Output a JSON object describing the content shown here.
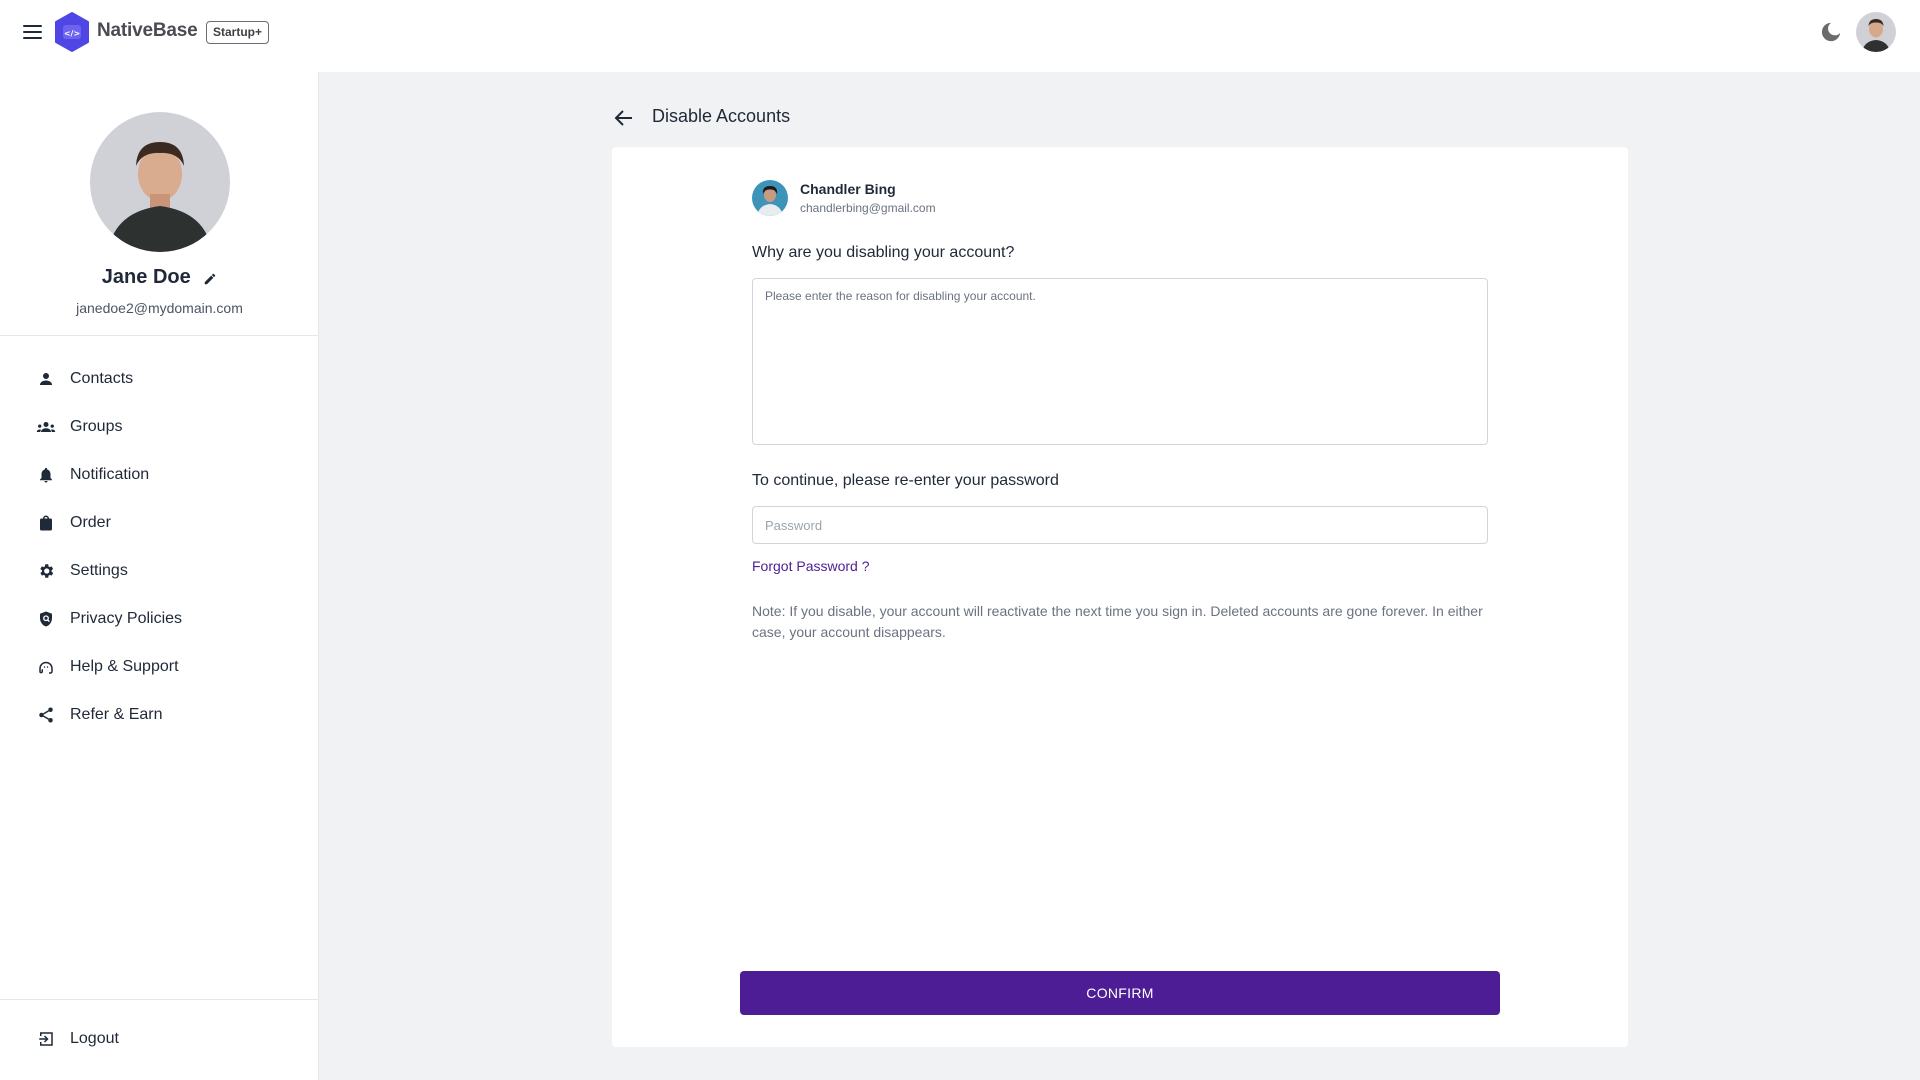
{
  "header": {
    "brand": "NativeBase",
    "plan_badge": "Startup+",
    "icons": {
      "menu": "hamburger-icon",
      "logo": "hexagon-code-icon",
      "theme": "moon-icon",
      "avatar": "user-avatar"
    }
  },
  "sidebar": {
    "profile": {
      "name": "Jane Doe",
      "email": "janedoe2@mydomain.com"
    },
    "items": [
      {
        "label": "Contacts",
        "icon": "person-icon"
      },
      {
        "label": "Groups",
        "icon": "groups-icon"
      },
      {
        "label": "Notification",
        "icon": "bell-icon"
      },
      {
        "label": "Order",
        "icon": "shopping-bag-icon"
      },
      {
        "label": "Settings",
        "icon": "gear-icon"
      },
      {
        "label": "Privacy Policies",
        "icon": "shield-icon"
      },
      {
        "label": "Help & Support",
        "icon": "headset-icon"
      },
      {
        "label": "Refer & Earn",
        "icon": "share-icon"
      }
    ],
    "logout": {
      "label": "Logout",
      "icon": "logout-icon"
    }
  },
  "main": {
    "title": "Disable Accounts",
    "user": {
      "name": "Chandler Bing",
      "email": "chandlerbing@gmail.com"
    },
    "reason_label": "Why are you disabling your account?",
    "reason_placeholder": "Please enter the reason for disabling your account.",
    "reason_value": "",
    "password_label": "To continue, please re-enter your password",
    "password_placeholder": "Password",
    "password_value": "",
    "forgot_label": "Forgot Password ?",
    "note": "Note: If you disable, your account will reactivate the next time you sign in. Deleted accounts are gone forever. In either case, your account disappears.",
    "confirm_label": "CONFIRM"
  },
  "colors": {
    "accent": "#4c1d95",
    "logo": "#4f46e5",
    "background": "#f1f2f4"
  }
}
